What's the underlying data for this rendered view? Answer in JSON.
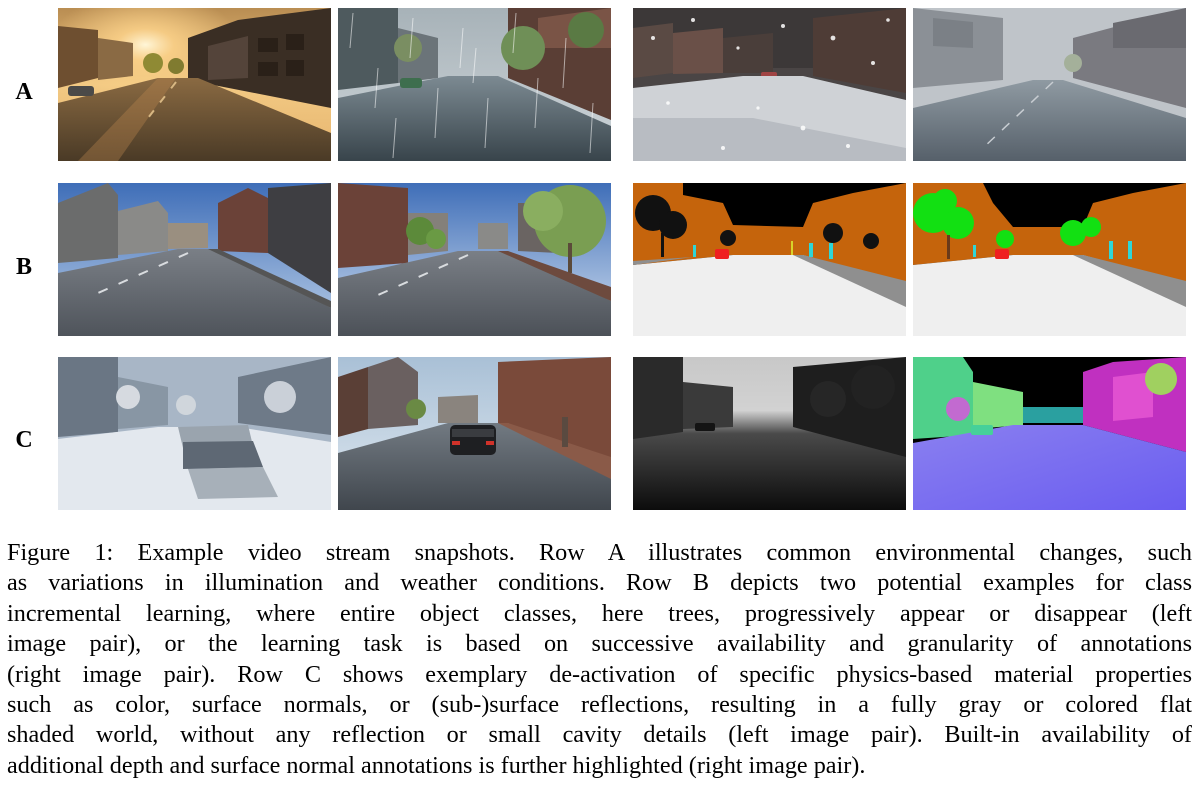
{
  "figure": {
    "row_labels": [
      "A",
      "B",
      "C"
    ],
    "panels": {
      "A": [
        "sunset-illumination",
        "rain",
        "snow",
        "fog"
      ],
      "B": [
        "street-without-trees",
        "street-with-trees",
        "semantic-segmentation-without-trees",
        "semantic-segmentation-with-trees"
      ],
      "C": [
        "flat-gray-shaded-world",
        "full-material-render",
        "depth-annotation",
        "surface-normal-annotation"
      ]
    }
  },
  "caption": {
    "lines": [
      "Figure 1: Example video stream snapshots. Row A illustrates common environmental changes, such",
      "as variations in illumination and weather conditions. Row B depicts two potential examples for class",
      "incremental learning, where entire object classes, here trees, progressively appear or disappear (left",
      "image pair), or the learning task is based on successive availability and granularity of annotations",
      "(right image pair). Row C shows exemplary de-activation of specific physics-based material properties",
      "such as color, surface normals, or (sub-)surface reflections, resulting in a fully gray or colored flat",
      "shaded world, without any reflection or small cavity details (left image pair). Built-in availability of",
      "additional depth and surface normal annotations is further highlighted (right image pair)."
    ]
  }
}
